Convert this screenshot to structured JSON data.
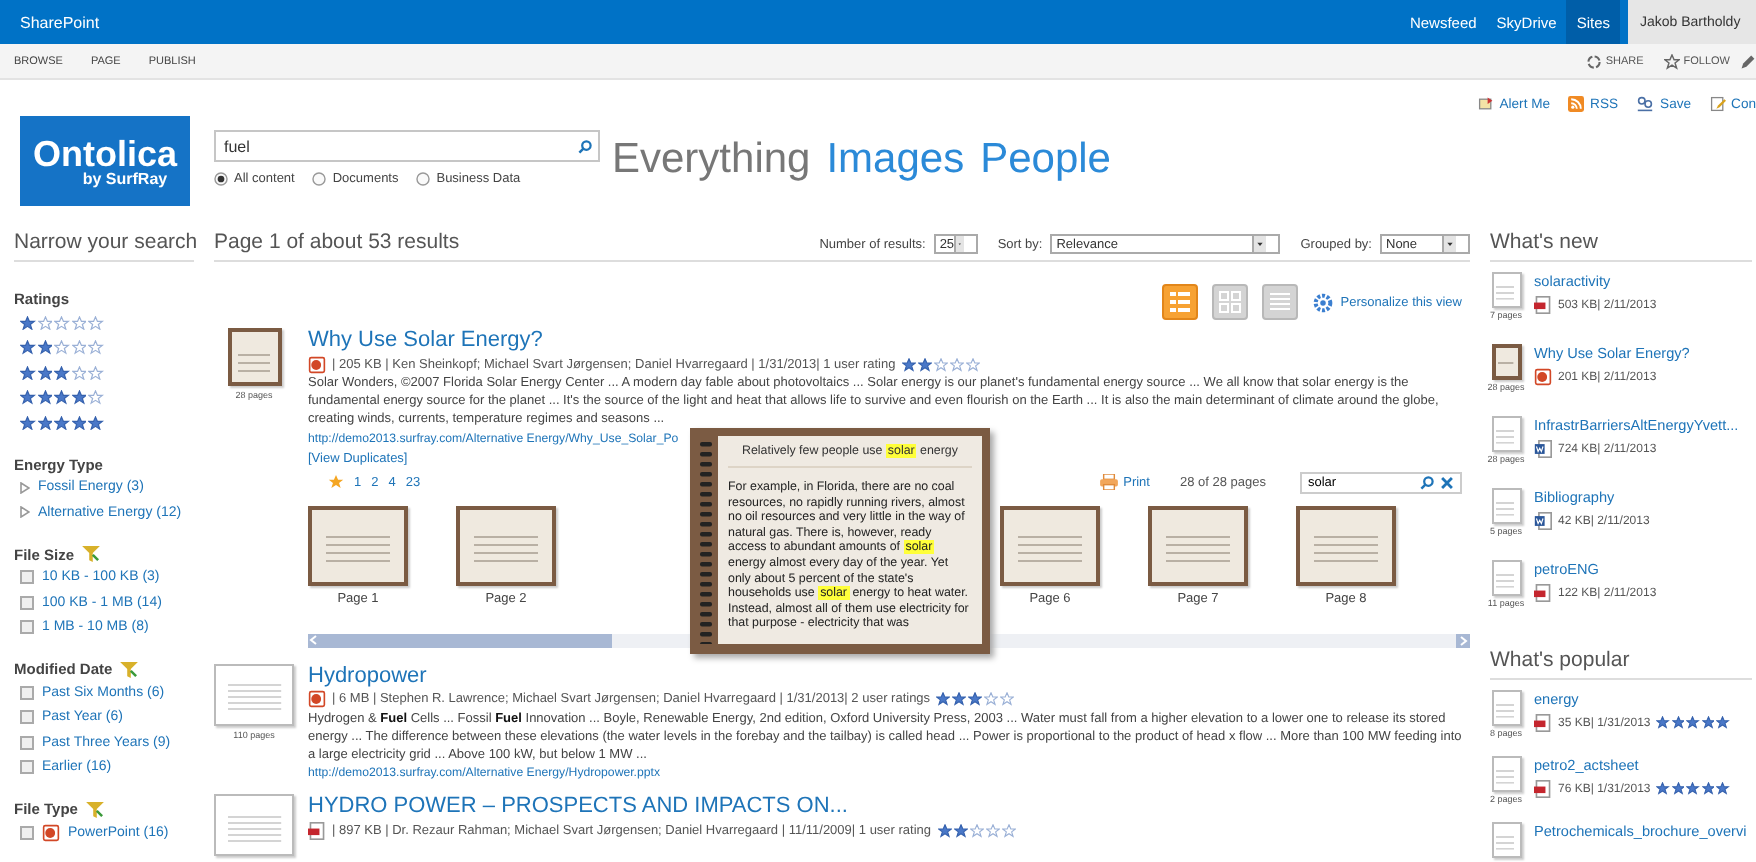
{
  "top_bar": {
    "title": "SharePoint",
    "links": [
      {
        "label": "Newsfeed",
        "selected": false
      },
      {
        "label": "SkyDrive",
        "selected": false
      },
      {
        "label": "Sites",
        "selected": true
      }
    ],
    "user": "Jakob Bartholdy"
  },
  "ribbon": {
    "tabs": [
      "BROWSE",
      "PAGE",
      "PUBLISH"
    ],
    "actions": [
      {
        "kind": "share",
        "label": "SHARE"
      },
      {
        "kind": "follow",
        "label": "FOLLOW"
      }
    ]
  },
  "page_actions": [
    {
      "kind": "alert",
      "label": "Alert Me"
    },
    {
      "kind": "rss",
      "label": "RSS"
    },
    {
      "kind": "save",
      "label": "Save"
    },
    {
      "kind": "edit",
      "label": "Con"
    }
  ],
  "logo": {
    "name": "Ontolica",
    "tagline": "by SurfRay"
  },
  "search": {
    "value": "fuel",
    "scopes": [
      {
        "label": "All content",
        "selected": true
      },
      {
        "label": "Documents",
        "selected": false
      },
      {
        "label": "Business Data",
        "selected": false
      }
    ]
  },
  "verticals": [
    {
      "label": "Everything",
      "selected": true
    },
    {
      "label": "Images",
      "selected": false
    },
    {
      "label": "People",
      "selected": false
    }
  ],
  "refiners": {
    "title": "Narrow your search",
    "groups": [
      {
        "kind": "rating",
        "title": "Ratings",
        "items": [
          {
            "stars": 1
          },
          {
            "stars": 2
          },
          {
            "stars": 3
          },
          {
            "stars": 4
          },
          {
            "stars": 5
          }
        ]
      },
      {
        "kind": "tree",
        "title": "Energy Type",
        "items": [
          {
            "label": "Fossil Energy (3)",
            "expanded": false
          },
          {
            "label": "Alternative Energy (12)",
            "expanded": false
          }
        ]
      },
      {
        "kind": "checkbox",
        "title": "File Size",
        "items": [
          {
            "label": "10 KB - 100 KB (3)",
            "checked": false
          },
          {
            "label": "100 KB - 1 MB (14)",
            "checked": false
          },
          {
            "label": "1 MB - 10 MB (8)",
            "checked": false
          }
        ]
      },
      {
        "kind": "checkbox",
        "title": "Modified Date",
        "items": [
          {
            "label": "Past Six Months (6)",
            "checked": false
          },
          {
            "label": "Past Year (6)",
            "checked": false
          },
          {
            "label": "Past Three Years (9)",
            "checked": false
          },
          {
            "label": "Earlier (16)",
            "checked": false
          }
        ]
      },
      {
        "kind": "checkbox",
        "title": "File Type",
        "items": [
          {
            "label": "PowerPoint (16)",
            "checked": false,
            "kind": "ppt"
          }
        ]
      }
    ]
  },
  "results": {
    "summary": "Page 1 of about 53 results",
    "controls": [
      {
        "label": "Number of results:",
        "value": "25"
      },
      {
        "label": "Sort by:",
        "value": "Relevance"
      },
      {
        "label": "Grouped by:",
        "value": "None"
      }
    ],
    "views": [
      {
        "kind": "list",
        "selected": true
      },
      {
        "kind": "grid",
        "selected": false
      },
      {
        "kind": "details",
        "selected": false
      }
    ],
    "personalize": "Personalize this view",
    "items": [
      {
        "title": "Why Use Solar Energy?",
        "kind": "ppt",
        "pages": "28 pages",
        "meta": "| 205 KB | Ken Sheinkopf; Michael Svart Jørgensen; Daniel Hvarregaard | 1/31/2013| 1 user rating",
        "stars": 2,
        "snippet": "Solar Wonders, ©2007 Florida Solar Energy Center ... A modern day fable about photovoltaics ... Solar energy is our planet's fundamental energy source ... We all know that solar energy is the fundamental energy source for the planet ... It's the source of the light and heat that allows life to survive and even flourish on the Earth ... It is also the main determinant of climate around the globe, creating winds, currents, temperature regimes and seasons ...",
        "url": "http://demo2013.surfray.com/Alternative Energy/Why_Use_Solar_Po",
        "duplicates": "[View Duplicates]",
        "preview": {
          "page_links": [
            "1",
            "2",
            "4",
            "23"
          ],
          "print": "Print",
          "page_count": "28 of 28 pages",
          "search_value": "solar",
          "pages_left": [
            {
              "label": "Page 1"
            },
            {
              "label": "Page 2"
            }
          ],
          "pages_right": [
            {
              "label": "Page 6"
            },
            {
              "label": "Page 7"
            },
            {
              "label": "Page 8"
            }
          ],
          "popup": {
            "title": "Relatively few people use **solar** energy",
            "text": "For example, in Florida, there are no coal resources, no rapidly running rivers, almost no oil resources and very little in the way of natural gas. There is, however, ready access to abundant amounts of **solar** energy almost every day of the year. Yet only about 5 percent of the state's households use **solar** energy to heat water. Instead, almost all of them use electricity for that purpose - electricity that was"
          }
        }
      },
      {
        "title": "Hydropower",
        "kind": "ppt",
        "pages": "110 pages",
        "meta": "| 6 MB | Stephen R. Lawrence; Michael Svart Jørgensen; Daniel Hvarregaard | 1/31/2013| 2 user ratings",
        "stars": 3,
        "snippet": "Hydrogen & **Fuel** Cells ... Fossil **Fuel** Innovation ... Boyle, Renewable Energy, 2nd edition, Oxford University Press, 2003 ... Water must fall from a higher elevation to a lower one to release its stored energy ... The difference between these elevations (the water levels in the forebay and the tailbay) is called head ... Power is proportional to the product of head x flow ... More than 100 MW feeding into a large electricity grid ... Above 100 kW, but below 1 MW ...",
        "url": "http://demo2013.surfray.com/Alternative Energy/Hydropower.pptx"
      },
      {
        "title": "HYDRO POWER – PROSPECTS AND IMPACTS ON...",
        "kind": "pdf",
        "meta": "| 897 KB | Dr. Rezaur Rahman; Michael Svart Jørgensen; Daniel Hvarregaard | 11/11/2009| 1 user rating",
        "stars": 2
      }
    ]
  },
  "sidebar": {
    "sections": [
      {
        "title": "What's new",
        "items": [
          {
            "title": "solaractivity",
            "kind": "pdf",
            "meta": "503 KB| 2/11/2013",
            "pages": "7 pages"
          },
          {
            "title": "Why Use Solar Energy?",
            "kind": "ppt",
            "meta": "201 KB| 2/11/2013",
            "pages": "28 pages"
          },
          {
            "title": "InfrastrBarriersAltEnergyYvett...",
            "kind": "doc",
            "meta": "724 KB| 2/11/2013",
            "pages": "28 pages"
          },
          {
            "title": "Bibliography",
            "kind": "doc",
            "meta": "42 KB| 2/11/2013",
            "pages": "5 pages"
          },
          {
            "title": "petroENG",
            "kind": "pdf",
            "meta": "122 KB| 2/11/2013",
            "pages": "11 pages"
          }
        ]
      },
      {
        "title": "What's popular",
        "items": [
          {
            "title": "energy",
            "kind": "pdf",
            "meta": "35 KB| 1/31/2013",
            "stars": 5,
            "pages": "8 pages"
          },
          {
            "title": "petro2_actsheet",
            "kind": "pdf",
            "meta": "76 KB| 1/31/2013",
            "stars": 5,
            "pages": "2 pages"
          },
          {
            "title": "Petrochemicals_brochure_overvi"
          }
        ]
      }
    ]
  }
}
